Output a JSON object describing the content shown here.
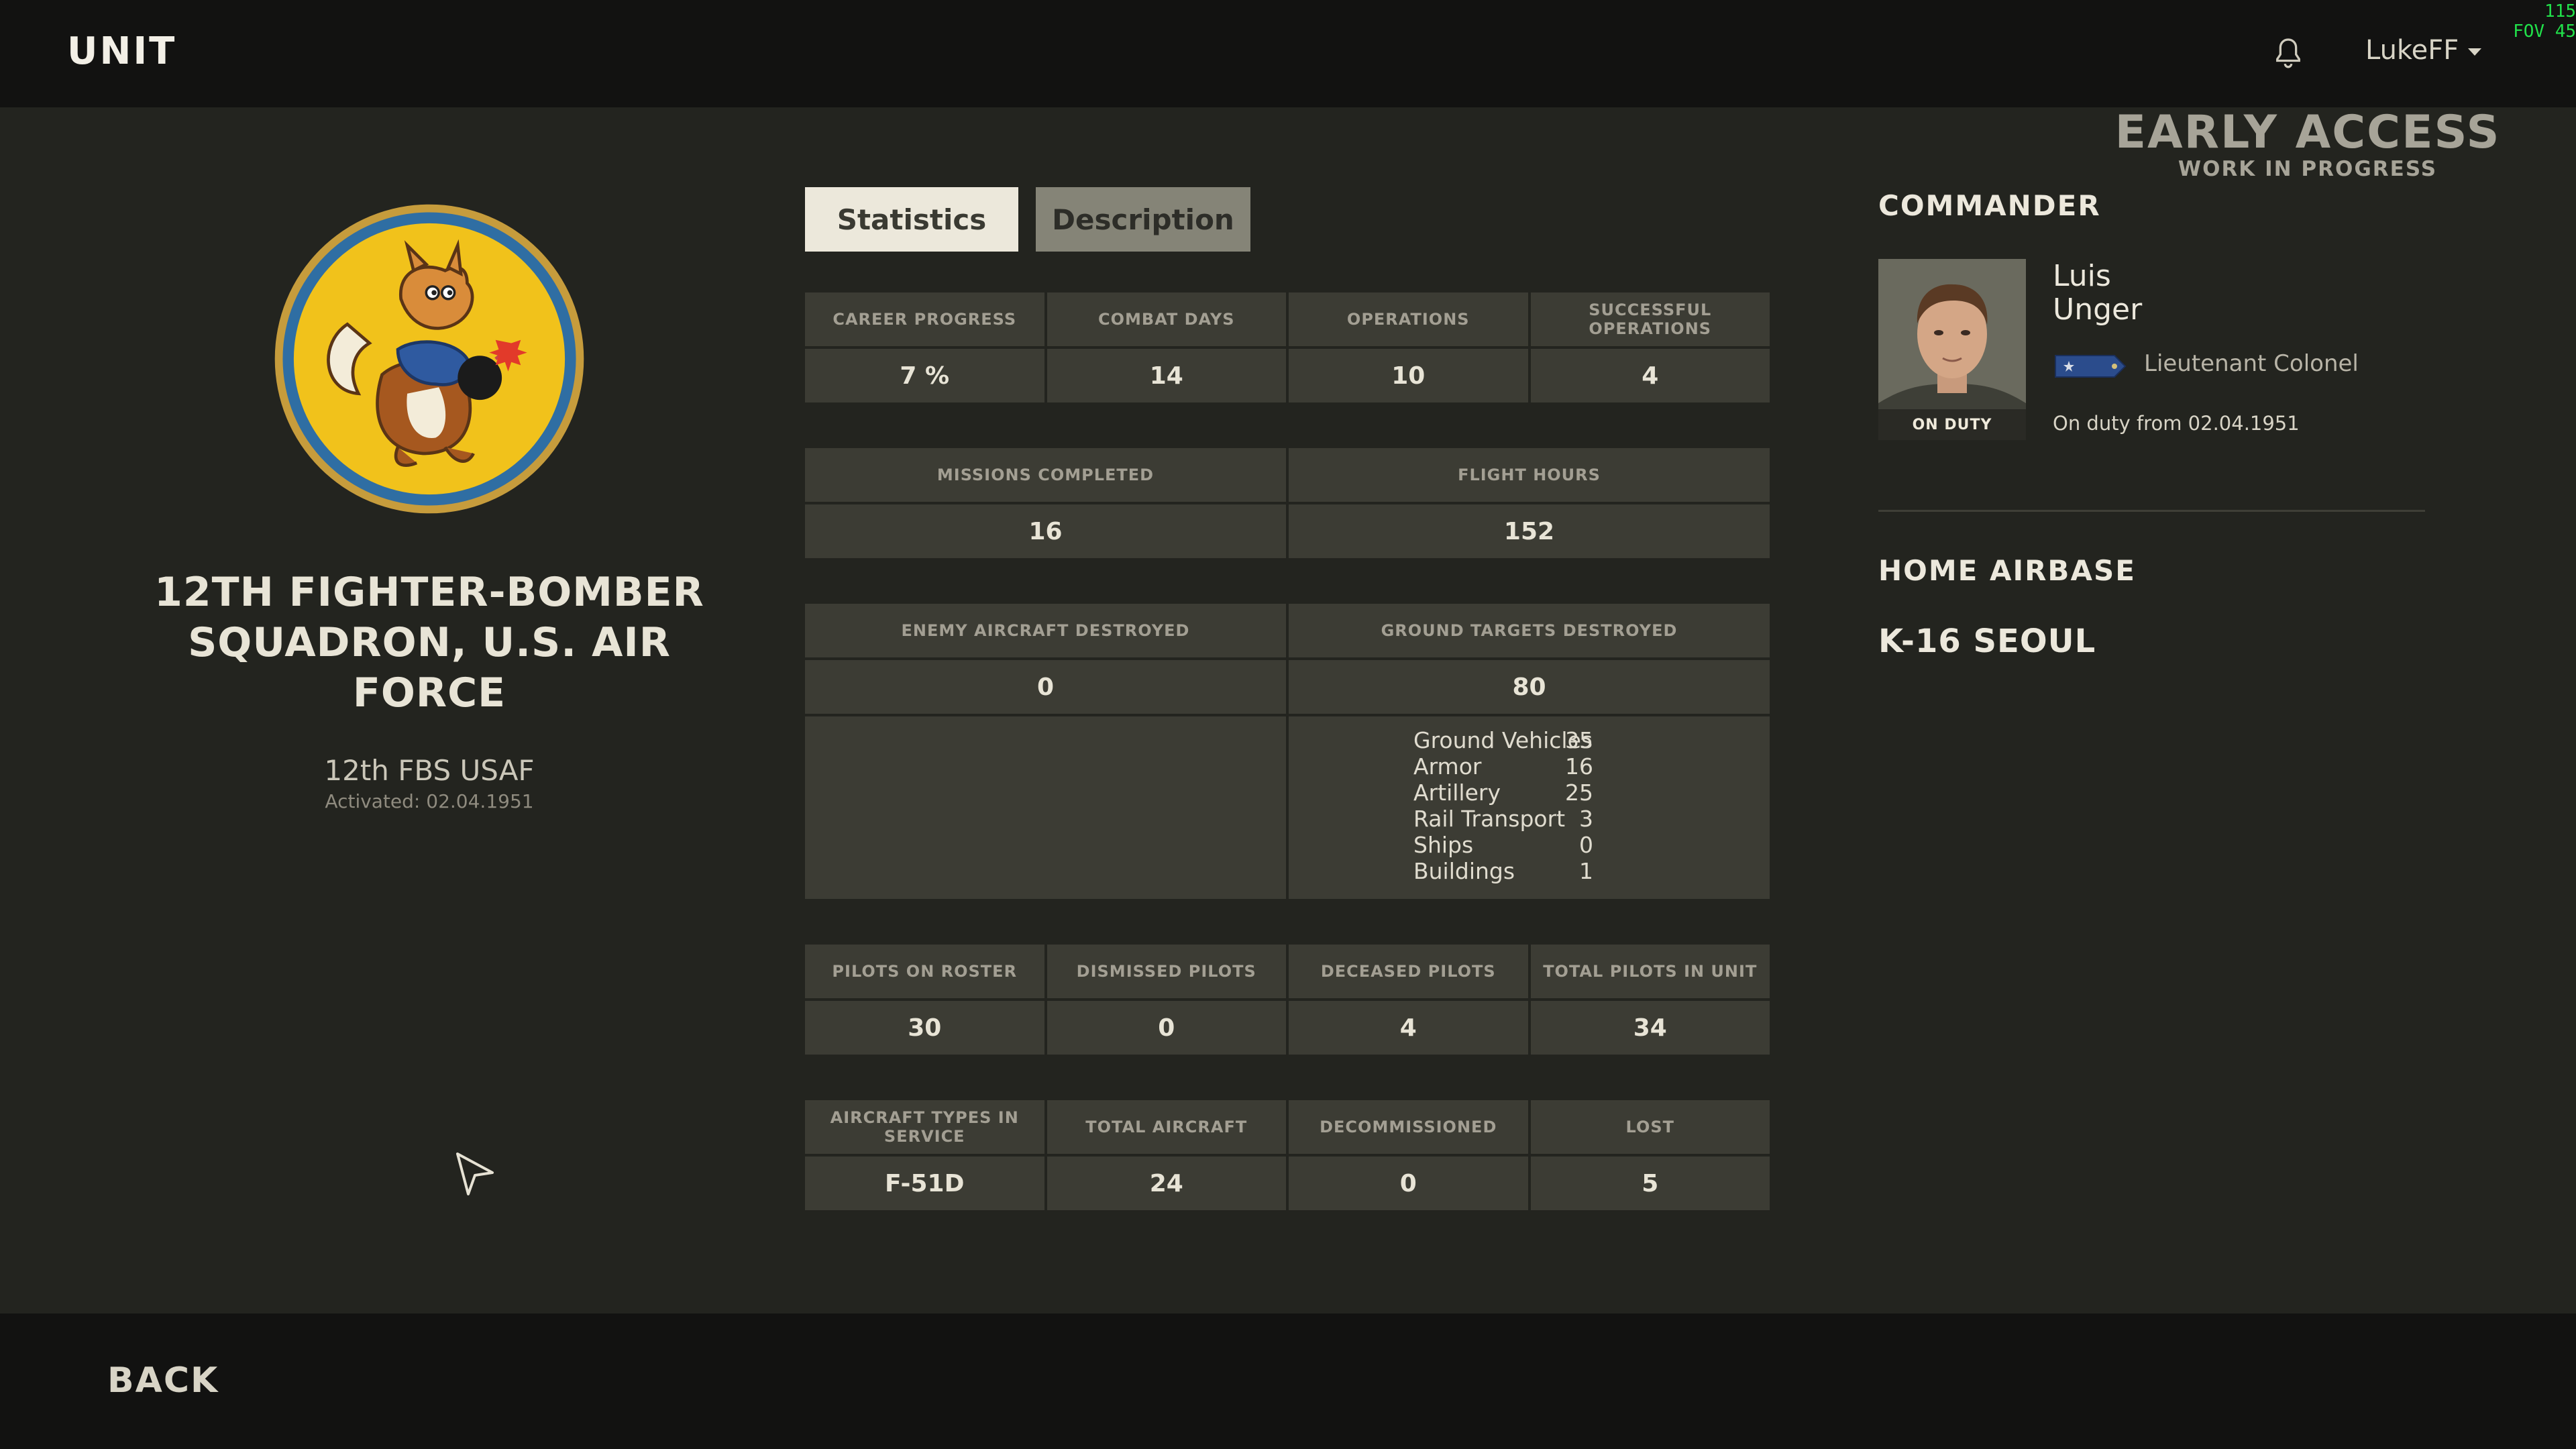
{
  "header": {
    "title": "UNIT",
    "username": "LukeFF",
    "overlay": [
      "115",
      "FOV 45"
    ]
  },
  "badge": {
    "title": "EARLY ACCESS",
    "subtitle": "WORK IN PROGRESS"
  },
  "unit": {
    "name": "12TH FIGHTER-BOMBER SQUADRON, U.S. AIR FORCE",
    "short_name": "12th FBS USAF",
    "activated": "Activated: 02.04.1951"
  },
  "tabs": [
    {
      "label": "Statistics",
      "active": true
    },
    {
      "label": "Description",
      "active": false
    }
  ],
  "stats": {
    "row1": [
      {
        "label": "CAREER PROGRESS",
        "value": "7 %"
      },
      {
        "label": "COMBAT DAYS",
        "value": "14"
      },
      {
        "label": "OPERATIONS",
        "value": "10"
      },
      {
        "label": "SUCCESSFUL OPERATIONS",
        "value": "4"
      }
    ],
    "row2": [
      {
        "label": "MISSIONS COMPLETED",
        "value": "16"
      },
      {
        "label": "FLIGHT HOURS",
        "value": "152"
      }
    ],
    "row3": [
      {
        "label": "ENEMY AIRCRAFT DESTROYED",
        "value": "0"
      },
      {
        "label": "GROUND TARGETS DESTROYED",
        "value": "80"
      }
    ],
    "ground_breakdown": [
      {
        "label": "Ground Vehicles",
        "value": "35"
      },
      {
        "label": "Armor",
        "value": "16"
      },
      {
        "label": "Artillery",
        "value": "25"
      },
      {
        "label": "Rail Transport",
        "value": "3"
      },
      {
        "label": "Ships",
        "value": "0"
      },
      {
        "label": "Buildings",
        "value": "1"
      }
    ],
    "row4": [
      {
        "label": "PILOTS ON ROSTER",
        "value": "30"
      },
      {
        "label": "DISMISSED PILOTS",
        "value": "0"
      },
      {
        "label": "DECEASED PILOTS",
        "value": "4"
      },
      {
        "label": "TOTAL PILOTS IN UNIT",
        "value": "34"
      }
    ],
    "row5": [
      {
        "label": "AIRCRAFT TYPES IN SERVICE",
        "value": "F-51D"
      },
      {
        "label": "TOTAL AIRCRAFT",
        "value": "24"
      },
      {
        "label": "DECOMMISSIONED",
        "value": "0"
      },
      {
        "label": "LOST",
        "value": "5"
      }
    ]
  },
  "commander": {
    "section_title": "COMMANDER",
    "first_name": "Luis",
    "last_name": "Unger",
    "rank": "Lieutenant Colonel",
    "status": "ON DUTY",
    "on_duty_since": "On duty from 02.04.1951"
  },
  "home_airbase": {
    "section_title": "HOME AIRBASE",
    "name": "K-16 SEOUL"
  },
  "footer": {
    "back_label": "BACK"
  },
  "colors": {
    "background": "#23241f",
    "bar": "#121211",
    "cell": "#3c3c34",
    "tab_active": "#ece8db",
    "tab_inactive": "#858477",
    "overlay_text": "#21e04a",
    "emblem_yellow": "#f1c21b",
    "emblem_ring": "#2f6ea3"
  },
  "icons": [
    "bell-icon",
    "caret-down-icon",
    "cursor-arrow-icon",
    "unit-emblem-icon",
    "rank-insignia-icon",
    "commander-portrait"
  ]
}
